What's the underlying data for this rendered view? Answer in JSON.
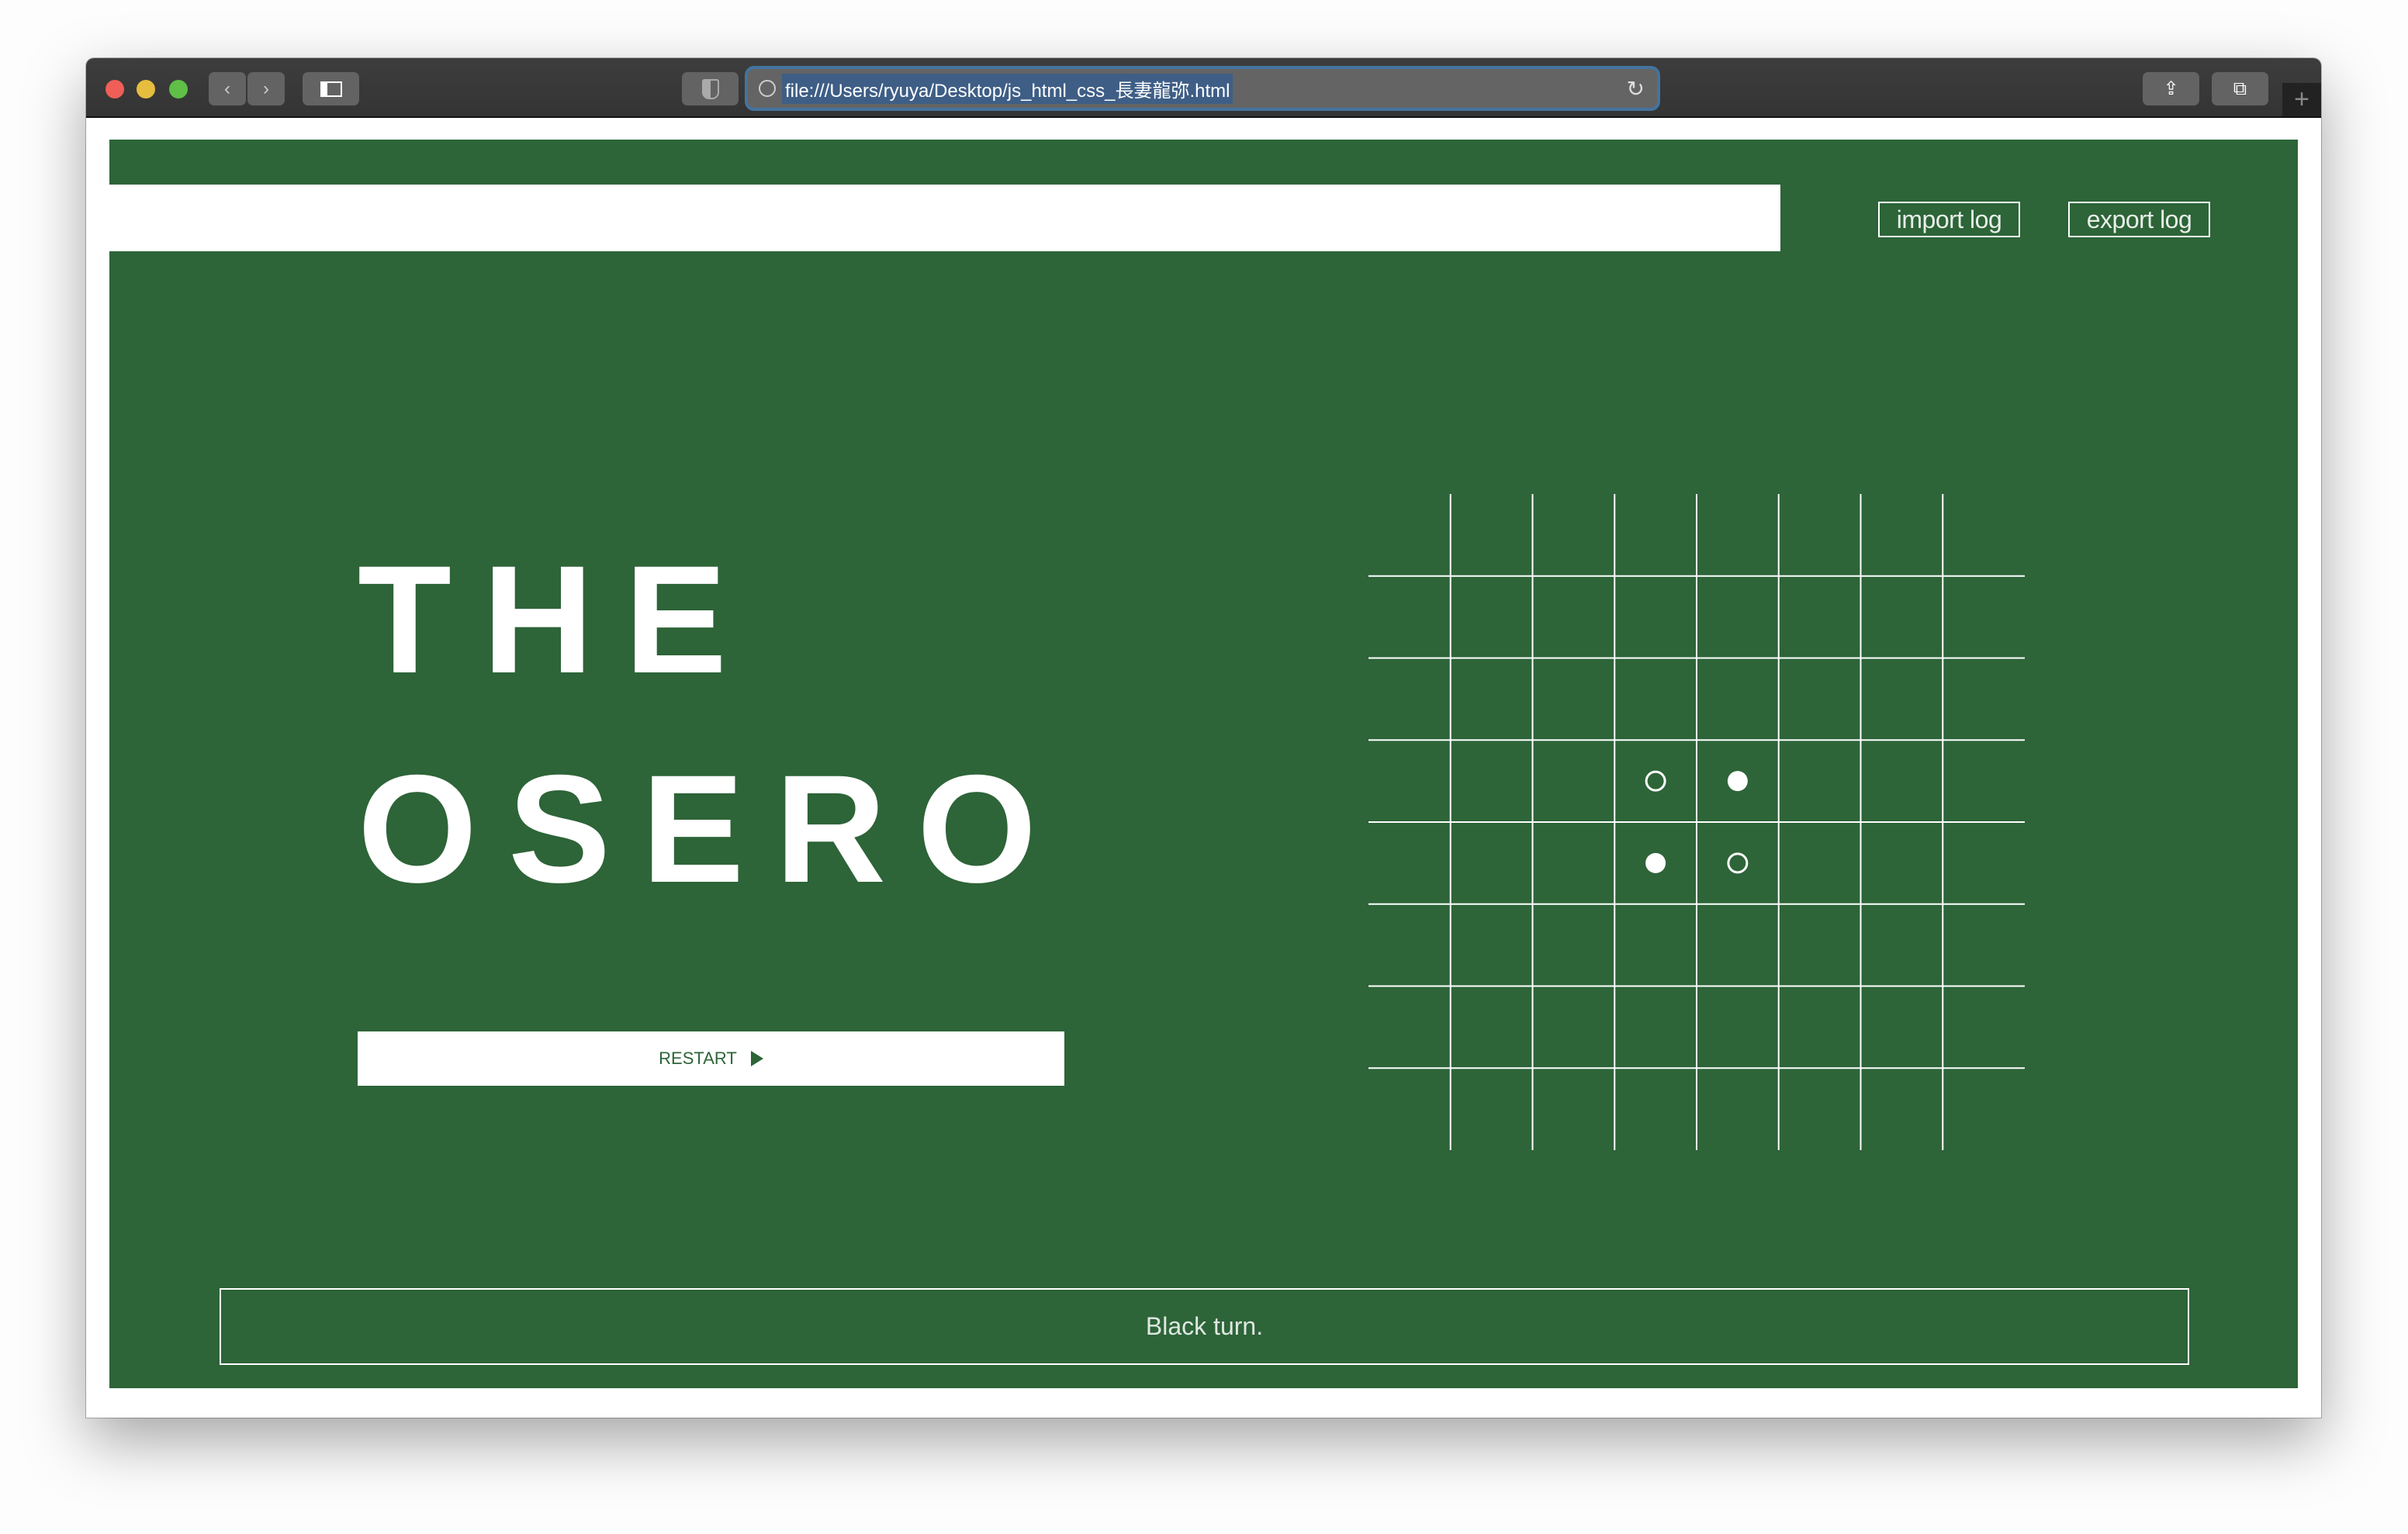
{
  "browser": {
    "url": "file:///Users/ryuya/Desktop/js_html_css_長妻龍弥.html",
    "colors": {
      "close": "#ef5f57",
      "minimize": "#e6bd3f",
      "zoom": "#5fbf47",
      "url_highlight": "#44739f"
    }
  },
  "page": {
    "import_label": "import log",
    "export_label": "export log",
    "title_line1": "THE",
    "title_line2": "OSERO",
    "restart_label": "RESTART",
    "status": "Black turn.",
    "colors": {
      "background": "#2d6438",
      "foreground": "#ffffff"
    }
  },
  "board": {
    "size": 8,
    "pieces": [
      {
        "row": 3,
        "col": 3,
        "style": "hollow"
      },
      {
        "row": 3,
        "col": 4,
        "style": "filled"
      },
      {
        "row": 4,
        "col": 3,
        "style": "filled"
      },
      {
        "row": 4,
        "col": 4,
        "style": "hollow"
      }
    ]
  }
}
